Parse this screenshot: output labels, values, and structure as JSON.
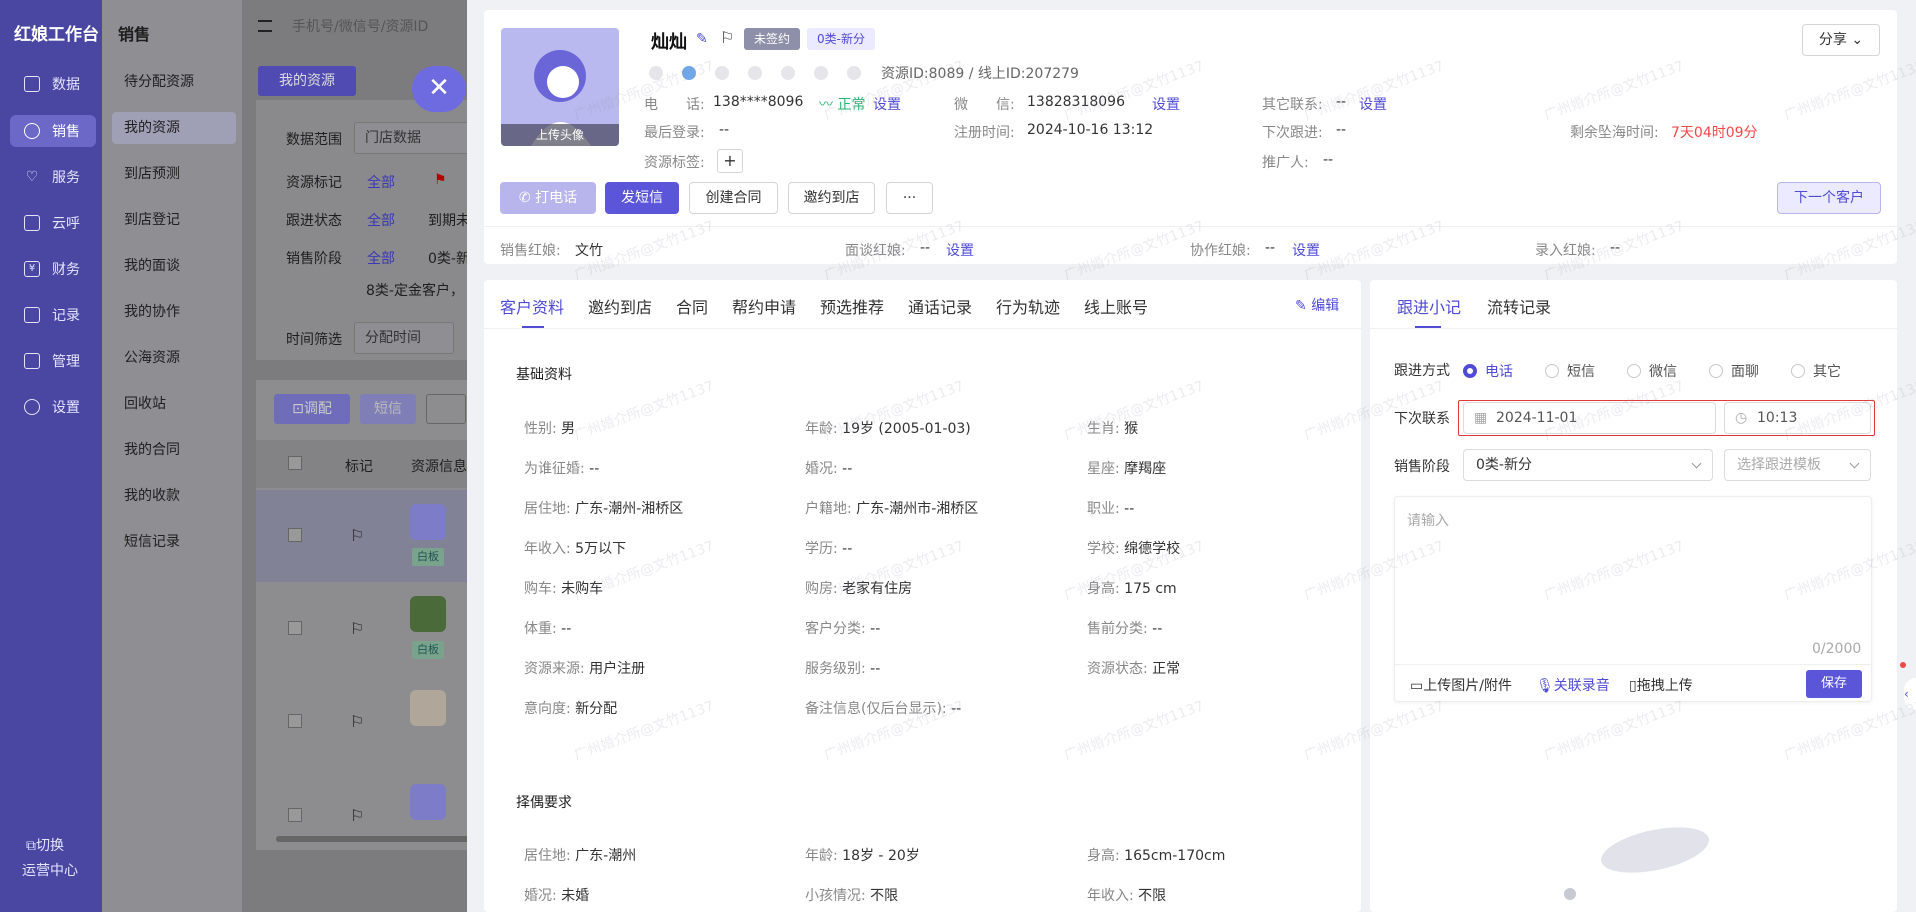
{
  "leftnav": {
    "brand": "红娘工作台",
    "items": [
      {
        "label": "数据",
        "icon": "chart-icon"
      },
      {
        "label": "销售",
        "icon": "sales-icon"
      },
      {
        "label": "服务",
        "icon": "heart-icon"
      },
      {
        "label": "云呼",
        "icon": "bar-chart-icon"
      },
      {
        "label": "财务",
        "icon": "yen-icon"
      },
      {
        "label": "记录",
        "icon": "document-icon"
      },
      {
        "label": "管理",
        "icon": "building-icon"
      },
      {
        "label": "设置",
        "icon": "gear-icon"
      }
    ],
    "switch_label": "切换",
    "ops_label": "运营中心"
  },
  "sidebar2": {
    "title": "销售",
    "items": [
      "待分配资源",
      "我的资源",
      "到店预测",
      "到店登记",
      "我的面谈",
      "我的协作",
      "公海资源",
      "回收站",
      "我的合同",
      "我的收款",
      "短信记录"
    ]
  },
  "background": {
    "search_placeholder": "手机号/微信号/资源ID",
    "my_resources_btn": "我的资源",
    "data_range_label": "数据范围",
    "data_range_value": "门店数据",
    "resource_mark_label": "资源标记",
    "follow_status_label": "跟进状态",
    "sales_stage_label": "销售阶段",
    "all": "全部",
    "status_partial": "到期未",
    "stage_partial": "0类-新",
    "stage_line2": "8类-定金客户，",
    "time_filter_label": "时间筛选",
    "time_filter_value": "分配时间",
    "transfer_btn": "调配",
    "sms_btn": "短信",
    "col_mark": "标记",
    "col_resource": "资源信息",
    "row_badge": "白板"
  },
  "profile": {
    "name": "灿灿",
    "tag_unsigned": "未签约",
    "tag_stage": "0类-新分",
    "resource_id": "资源ID:8089",
    "online_id": "线上ID:207279",
    "phone_label": "电　　话:",
    "phone_value": "138****8096",
    "phone_status": "正常",
    "set": "设置",
    "wechat_label": "微　　信:",
    "wechat_value": "13828318096",
    "other_contact_label": "其它联系:",
    "other_contact_value": "--",
    "last_login_label": "最后登录:",
    "last_login_value": "--",
    "register_time_label": "注册时间:",
    "register_time_value": "2024-10-16 13:12",
    "next_follow_label": "下次跟进:",
    "next_follow_value": "--",
    "sea_time_label": "剩余坠海时间:",
    "sea_time_value": "7天04时09分",
    "resource_tag_label": "资源标签:",
    "referrer_label": "推广人:",
    "referrer_value": "--",
    "upload_avatar": "上传头像",
    "share": "分享",
    "btn_call": "打电话",
    "btn_sms": "发短信",
    "btn_contract": "创建合同",
    "btn_invite": "邀约到店",
    "btn_more": "···",
    "btn_next": "下一个客户",
    "sales_matchmaker_label": "销售红娘:",
    "sales_matchmaker_value": "文竹",
    "interview_matchmaker_label": "面谈红娘:",
    "interview_matchmaker_value": "--",
    "assist_matchmaker_label": "协作红娘:",
    "assist_matchmaker_value": "--",
    "entry_matchmaker_label": "录入红娘:",
    "entry_matchmaker_value": "--"
  },
  "tabs": [
    "客户资料",
    "邀约到店",
    "合同",
    "帮约申请",
    "预选推荐",
    "通话记录",
    "行为轨迹",
    "线上账号"
  ],
  "edit_label": "编辑",
  "basic": {
    "title": "基础资料",
    "fields": [
      {
        "k": "性别:",
        "v": "男"
      },
      {
        "k": "年龄:",
        "v": "19岁 (2005-01-03)"
      },
      {
        "k": "生肖:",
        "v": "猴"
      },
      {
        "k": "为谁征婚:",
        "v": "--"
      },
      {
        "k": "婚况:",
        "v": "--"
      },
      {
        "k": "星座:",
        "v": "摩羯座"
      },
      {
        "k": "居住地:",
        "v": "广东-潮州-湘桥区"
      },
      {
        "k": "户籍地:",
        "v": "广东-潮州市-湘桥区"
      },
      {
        "k": "职业:",
        "v": "--"
      },
      {
        "k": "年收入:",
        "v": "5万以下"
      },
      {
        "k": "学历:",
        "v": "--"
      },
      {
        "k": "学校:",
        "v": "绵德学校"
      },
      {
        "k": "购车:",
        "v": "未购车"
      },
      {
        "k": "购房:",
        "v": "老家有住房"
      },
      {
        "k": "身高:",
        "v": "175 cm"
      },
      {
        "k": "体重:",
        "v": "--"
      },
      {
        "k": "客户分类:",
        "v": "--"
      },
      {
        "k": "售前分类:",
        "v": "--"
      },
      {
        "k": "资源来源:",
        "v": "用户注册"
      },
      {
        "k": "服务级别:",
        "v": "--"
      },
      {
        "k": "资源状态:",
        "v": "正常"
      },
      {
        "k": "意向度:",
        "v": "新分配"
      },
      {
        "k": "备注信息(仅后台显示):",
        "v": "--"
      }
    ]
  },
  "mate": {
    "title": "择偶要求",
    "fields": [
      {
        "k": "居住地:",
        "v": "广东-潮州"
      },
      {
        "k": "年龄:",
        "v": "18岁 - 20岁"
      },
      {
        "k": "身高:",
        "v": "165cm-170cm"
      },
      {
        "k": "婚况:",
        "v": "未婚"
      },
      {
        "k": "小孩情况:",
        "v": "不限"
      },
      {
        "k": "年收入:",
        "v": "不限"
      }
    ]
  },
  "follow": {
    "tab_notes": "跟进小记",
    "tab_transfer": "流转记录",
    "method_label": "跟进方式",
    "methods": [
      "电话",
      "短信",
      "微信",
      "面聊",
      "其它"
    ],
    "selected_method": "电话",
    "next_contact_label": "下次联系",
    "next_date": "2024-11-01",
    "next_time": "10:13",
    "stage_label": "销售阶段",
    "stage_value": "0类-新分",
    "template_placeholder": "选择跟进模板",
    "textarea_placeholder": "请输入",
    "counter": "0/2000",
    "upload_label": "上传图片/附件",
    "voice_label": "关联录音",
    "drag_label": "拖拽上传",
    "save_label": "保存"
  },
  "watermark_text": "广州婚介所@文竹1137",
  "colors": {
    "accent": "#4f4bd6",
    "nav_bg": "#4a47a3",
    "danger": "#f04848",
    "ok": "#2bb673"
  }
}
